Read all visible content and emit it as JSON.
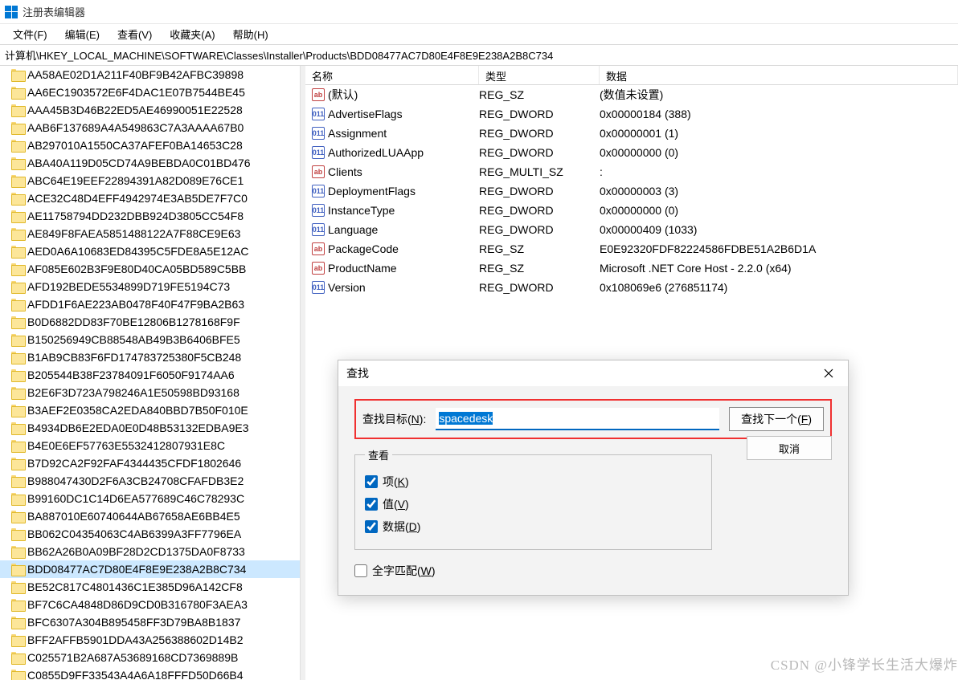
{
  "window": {
    "title": "注册表编辑器"
  },
  "menu": {
    "file": "文件(F)",
    "edit": "编辑(E)",
    "view": "查看(V)",
    "favorites": "收藏夹(A)",
    "help": "帮助(H)"
  },
  "address": "计算机\\HKEY_LOCAL_MACHINE\\SOFTWARE\\Classes\\Installer\\Products\\BDD08477AC7D80E4F8E9E238A2B8C734",
  "columns": {
    "name": "名称",
    "type": "类型",
    "data": "数据"
  },
  "tree": {
    "items": [
      "AA58AE02D1A211F40BF9B42AFBC39898",
      "AA6EC1903572E6F4DAC1E07B7544BE45",
      "AAA45B3D46B22ED5AE46990051E22528",
      "AAB6F137689A4A549863C7A3AAAA67B0",
      "AB297010A1550CA37AFEF0BA14653C28",
      "ABA40A119D05CD74A9BEBDA0C01BD476",
      "ABC64E19EEF22894391A82D089E76CE1",
      "ACE32C48D4EFF4942974E3AB5DE7F7C0",
      "AE11758794DD232DBB924D3805CC54F8",
      "AE849F8FAEA5851488122A7F88CE9E63",
      "AED0A6A10683ED84395C5FDE8A5E12AC",
      "AF085E602B3F9E80D40CA05BD589C5BB",
      "AFD192BEDE5534899D719FE5194C73",
      "AFDD1F6AE223AB0478F40F47F9BA2B63",
      "B0D6882DD83F70BE12806B1278168F9F",
      "B150256949CB88548AB49B3B6406BFE5",
      "B1AB9CB83F6FD174783725380F5CB248",
      "B205544B38F23784091F6050F9174AA6",
      "B2E6F3D723A798246A1E50598BD93168",
      "B3AEF2E0358CA2EDA840BBD7B50F010E",
      "B4934DB6E2EDA0E0D48B53132EDBA9E3",
      "B4E0E6EF57763E5532412807931E8C",
      "B7D92CA2F92FAF4344435CFDF1802646",
      "B988047430D2F6A3CB24708CFAFDB3E2",
      "B99160DC1C14D6EA577689C46C78293C",
      "BA887010E60740644AB67658AE6BB4E5",
      "BB062C04354063C4AB6399A3FF7796EA",
      "BB62A26B0A09BF28D2CD1375DA0F8733",
      "BDD08477AC7D80E4F8E9E238A2B8C734",
      "BE52C817C4801436C1E385D96A142CF8",
      "BF7C6CA4848D86D9CD0B316780F3AEA3",
      "BFC6307A304B895458FF3D79BA8B1837",
      "BFF2AFFB5901DDA43A256388602D14B2",
      "C025571B2A687A53689168CD7369889B",
      "C0855D9FF33543A4A6A18FFFD50D66B4"
    ],
    "selected_index": 28
  },
  "values": [
    {
      "icon": "str",
      "name": "(默认)",
      "type": "REG_SZ",
      "data": "(数值未设置)"
    },
    {
      "icon": "bin",
      "name": "AdvertiseFlags",
      "type": "REG_DWORD",
      "data": "0x00000184 (388)"
    },
    {
      "icon": "bin",
      "name": "Assignment",
      "type": "REG_DWORD",
      "data": "0x00000001 (1)"
    },
    {
      "icon": "bin",
      "name": "AuthorizedLUAApp",
      "type": "REG_DWORD",
      "data": "0x00000000 (0)"
    },
    {
      "icon": "str",
      "name": "Clients",
      "type": "REG_MULTI_SZ",
      "data": ":"
    },
    {
      "icon": "bin",
      "name": "DeploymentFlags",
      "type": "REG_DWORD",
      "data": "0x00000003 (3)"
    },
    {
      "icon": "bin",
      "name": "InstanceType",
      "type": "REG_DWORD",
      "data": "0x00000000 (0)"
    },
    {
      "icon": "bin",
      "name": "Language",
      "type": "REG_DWORD",
      "data": "0x00000409 (1033)"
    },
    {
      "icon": "str",
      "name": "PackageCode",
      "type": "REG_SZ",
      "data": "E0E92320FDF82224586FDBE51A2B6D1A"
    },
    {
      "icon": "str",
      "name": "ProductName",
      "type": "REG_SZ",
      "data": "Microsoft .NET Core Host - 2.2.0 (x64)"
    },
    {
      "icon": "bin",
      "name": "Version",
      "type": "REG_DWORD",
      "data": "0x108069e6 (276851174)"
    }
  ],
  "find": {
    "title": "查找",
    "label_prefix": "查找目标(",
    "label_key": "N",
    "label_suffix": "):",
    "input_value": "spacedesk",
    "find_next_prefix": "查找下一个(",
    "find_next_key": "F",
    "find_next_suffix": ")",
    "cancel": "取消",
    "look_at": "查看",
    "keys_prefix": "项(",
    "keys_key": "K",
    "keys_suffix": ")",
    "values_prefix": "值(",
    "values_key": "V",
    "values_suffix": ")",
    "data_prefix": "数据(",
    "data_key": "D",
    "data_suffix": ")",
    "whole_prefix": "全字匹配(",
    "whole_key": "W",
    "whole_suffix": ")"
  },
  "watermark": "CSDN @小锋学长生活大爆炸"
}
